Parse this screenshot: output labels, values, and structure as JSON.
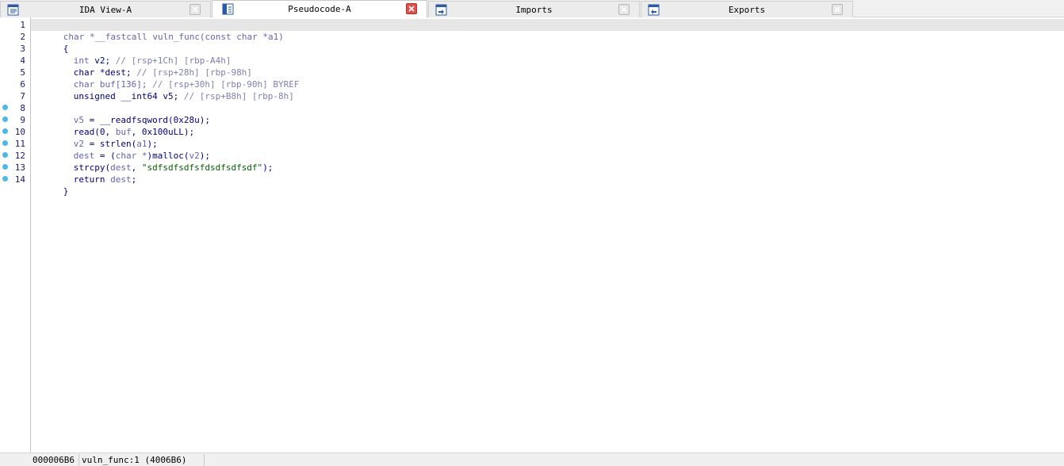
{
  "tabs": [
    {
      "label": "IDA View-A",
      "icon": "disassembly-view-icon",
      "active": false
    },
    {
      "label": "Pseudocode-A",
      "icon": "pseudocode-icon",
      "active": true
    },
    {
      "label": "Imports",
      "icon": "imports-icon",
      "active": false
    },
    {
      "label": "Exports",
      "icon": "exports-icon",
      "active": false
    }
  ],
  "code": {
    "lines": [
      {
        "num": "1",
        "breakpoint": false
      },
      {
        "num": "2",
        "breakpoint": false
      },
      {
        "num": "3",
        "breakpoint": false
      },
      {
        "num": "4",
        "breakpoint": false
      },
      {
        "num": "5",
        "breakpoint": false
      },
      {
        "num": "6",
        "breakpoint": false
      },
      {
        "num": "7",
        "breakpoint": false
      },
      {
        "num": "8",
        "breakpoint": true
      },
      {
        "num": "9",
        "breakpoint": true
      },
      {
        "num": "10",
        "breakpoint": true
      },
      {
        "num": "11",
        "breakpoint": true
      },
      {
        "num": "12",
        "breakpoint": true
      },
      {
        "num": "13",
        "breakpoint": true
      },
      {
        "num": "14",
        "breakpoint": true
      }
    ],
    "l1": {
      "a": "char *__fastcall vuln_func(const char *a1)"
    },
    "l2": {
      "a": "{"
    },
    "l3": {
      "a": "int",
      "b": " v2; ",
      "c": "// [rsp+1Ch] [rbp-A4h]"
    },
    "l4": {
      "a": "char",
      "b": " *dest; ",
      "c": "// [rsp+28h] [rbp-98h]"
    },
    "l5": {
      "a": "char buf[136]; ",
      "c": "// [rsp+30h] [rbp-90h] BYREF"
    },
    "l6": {
      "a": "unsigned __int64",
      "b": " v5; ",
      "c": "// [rsp+B8h] [rbp-8h]"
    },
    "l8": {
      "a": "v5",
      "b": " = __readfsqword(0x28u);"
    },
    "l9": {
      "a": "read(0, ",
      "b": "buf",
      "c": ", 0x100uLL);"
    },
    "l10": {
      "a": "v2",
      "b": " = strlen(",
      "c": "a1",
      "d": ");"
    },
    "l11": {
      "a": "dest",
      "b": " = (",
      "c": "char *",
      "d": ")malloc(",
      "e": "v2",
      "f": ");"
    },
    "l12": {
      "a": "strcpy(",
      "b": "dest",
      "c": ", ",
      "d": "\"sdfsdfsdfsfdsdfsdfsdf\"",
      "e": ");"
    },
    "l13": {
      "a": "return ",
      "b": "dest",
      "c": ";"
    },
    "l14": {
      "a": "}"
    }
  },
  "status": {
    "address": "000006B6",
    "location": "vuln_func:1 (4006B6)"
  },
  "colors": {
    "breakpoint": "#4db8e8",
    "close_active": "#d9534f",
    "highlight": "#e6e6e6"
  }
}
